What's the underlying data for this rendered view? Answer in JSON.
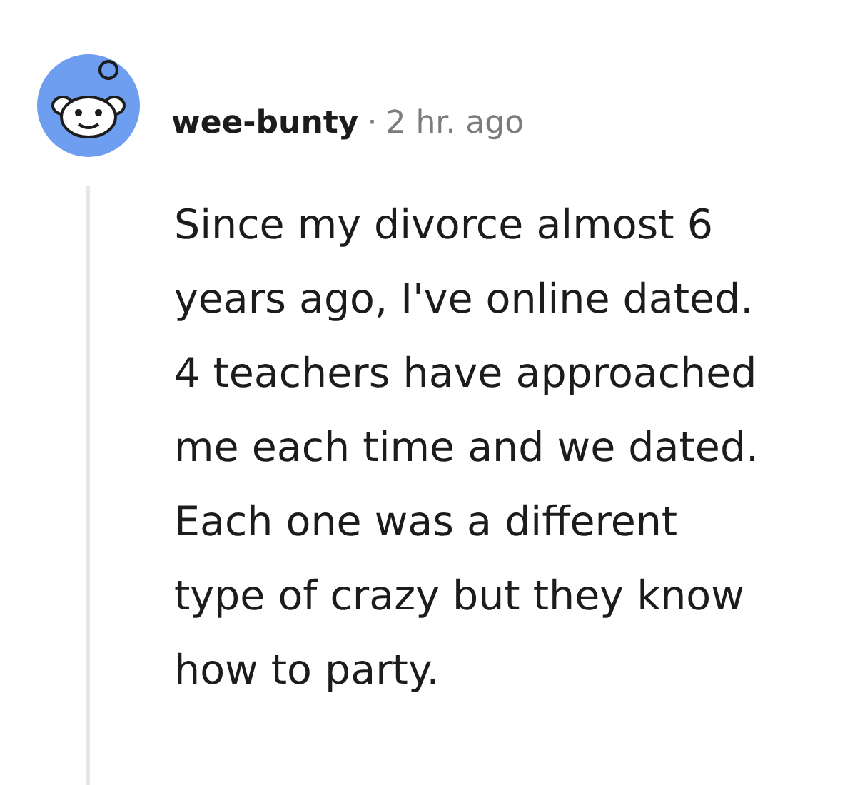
{
  "comment": {
    "author": "wee-bunty",
    "separator": "·",
    "time": "2 hr. ago",
    "body": "Since my divorce almost 6 years ago, I've online dated. 4 teachers have approached me each time and we dated. Each one was a different type of crazy but they know how to party."
  }
}
